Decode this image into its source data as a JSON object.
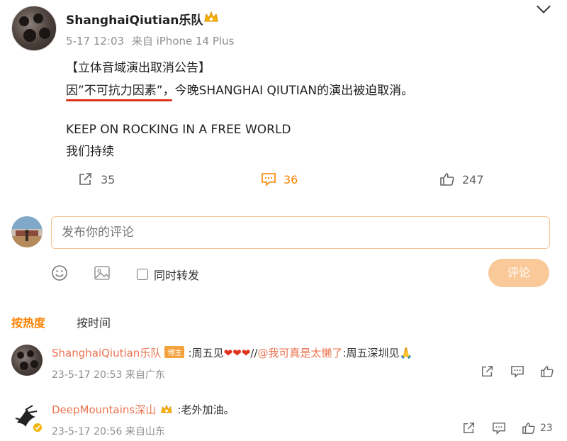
{
  "post": {
    "username": "ShanghaiQiutian乐队",
    "timestamp": "5-17 12:03",
    "source": "来自 iPhone 14 Plus",
    "line1": "【立体音域演出取消公告】",
    "line2_highlight": "因”不可抗力因素”",
    "line2_rest": "，今晚SHANGHAI QIUTIAN的演出被迫取消。",
    "line3": "KEEP ON ROCKING IN A FREE WORLD",
    "line4": "我们持续",
    "repost_count": "35",
    "comment_count": "36",
    "like_count": "247"
  },
  "composer": {
    "placeholder": "发布你的评论",
    "repost_label": "同时转发",
    "submit_label": "评论"
  },
  "sort": {
    "hot": "按热度",
    "time": "按时间"
  },
  "comments": [
    {
      "name": "ShanghaiQiutian乐队",
      "badge": "博主",
      "text_prefix": ":周五见",
      "hearts": "❤❤❤",
      "sep": "//",
      "mention": "@我可真是太懒了",
      "text_suffix": ":周五深圳见",
      "emoji": "🙏",
      "meta": "23-5-17 20:53 来自广东"
    },
    {
      "name": "DeepMountains深山",
      "text": ":老外加油。",
      "meta": "23-5-17 20:56 来自山东",
      "likes": "23"
    }
  ],
  "colors": {
    "accent": "#ff8200",
    "name": "#eb7350",
    "underline": "#e0311b",
    "input_border": "#f7c493",
    "button": "#f9c99a"
  }
}
